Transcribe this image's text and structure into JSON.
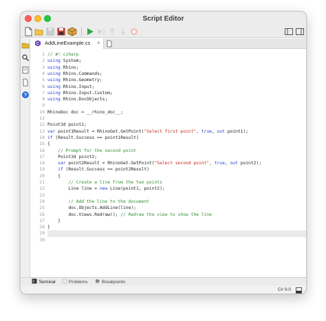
{
  "window": {
    "title": "Script Editor"
  },
  "toolbar": {
    "buttons": [
      "new-file",
      "open-file",
      "save-disabled",
      "save",
      "package",
      "run",
      "debug-restart",
      "step-over",
      "step-out",
      "stop"
    ],
    "right_buttons": [
      "toggle-left-panel",
      "toggle-right-panel"
    ]
  },
  "sidebar": {
    "icons": [
      "folder-icon",
      "search-icon",
      "libraries-icon",
      "document-icon",
      "help-icon"
    ]
  },
  "tabs": [
    {
      "label": "AddLineExample.cs",
      "close": "×"
    }
  ],
  "editor": {
    "current_line": 29,
    "lines": [
      "// #! csharp",
      "using System;",
      "using Rhino;",
      "using Rhino.Commands;",
      "using Rhino.Geometry;",
      "using Rhino.Input;",
      "using Rhino.Input.Custom;",
      "using Rhino.DocObjects;",
      "",
      "RhinoDoc doc = __rhino_doc__;",
      "",
      "Point3d point1;",
      "var point1Result = RhinoGet.GetPoint(\"Select first point\", true, out point1);",
      "if (Result.Success == point1Result)",
      "{",
      "    // Prompt for the second point",
      "    Point3d point2;",
      "    var point2Result = RhinoGet.GetPoint(\"Select second point\", true, out point2);",
      "    if (Result.Success == point2Result)",
      "    {",
      "        // Create a line from the two points",
      "        Line line = new Line(point1, point2);",
      "",
      "        // Add the line to the document",
      "        doc.Objects.AddLine(line);",
      "        doc.Views.Redraw(); // Redraw the view to show the line",
      "    }",
      "}",
      "",
      ""
    ]
  },
  "bottom_tabs": [
    {
      "label": "Terminal",
      "icon": "terminal-icon"
    },
    {
      "label": "Problems",
      "icon": "problems-icon"
    },
    {
      "label": "Breakpoints",
      "icon": "breakpoints-icon"
    }
  ],
  "status": {
    "language": "C# 9.0"
  },
  "colors": {
    "keyword": "#1f3fd1",
    "string": "#c4271b",
    "comment": "#2f8f2f",
    "type": "#1c1c1c"
  }
}
